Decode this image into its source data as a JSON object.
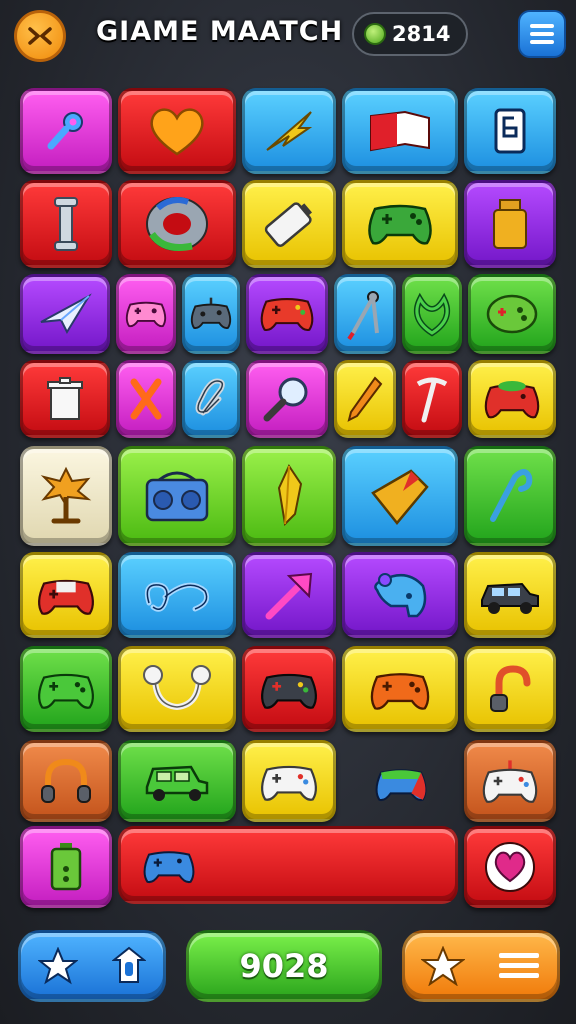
{
  "header": {
    "title": "GIAME MAATCH",
    "coins": "2814",
    "close_icon": "close-icon",
    "menu_icon": "hamburger-menu-icon"
  },
  "board": {
    "tiles": [
      {
        "name": "wrench",
        "color": "magenta"
      },
      {
        "name": "heart",
        "color": "red"
      },
      {
        "name": "leaf",
        "color": "blue"
      },
      {
        "name": "flag",
        "color": "blue"
      },
      {
        "name": "phone",
        "color": "blue"
      },
      {
        "name": "bone",
        "color": "red"
      },
      {
        "name": "ring",
        "color": "red"
      },
      {
        "name": "battery",
        "color": "yellow"
      },
      {
        "name": "gamepad",
        "color": "yellow"
      },
      {
        "name": "jar",
        "color": "purple"
      },
      {
        "name": "plane",
        "color": "purple"
      },
      {
        "name": "gamepad",
        "color": "magenta"
      },
      {
        "name": "gamepad",
        "color": "blue"
      },
      {
        "name": "gamepad",
        "color": "purple"
      },
      {
        "name": "tool",
        "color": "blue"
      },
      {
        "name": "knot",
        "color": "green"
      },
      {
        "name": "blob",
        "color": "green"
      },
      {
        "name": "trash",
        "color": "red"
      },
      {
        "name": "cross",
        "color": "magenta"
      },
      {
        "name": "clip",
        "color": "blue"
      },
      {
        "name": "magnifier",
        "color": "magenta"
      },
      {
        "name": "pencil",
        "color": "yellow"
      },
      {
        "name": "pickaxe",
        "color": "red"
      },
      {
        "name": "gamepad",
        "color": "yellow"
      },
      {
        "name": "tree",
        "color": "cream"
      },
      {
        "name": "boombox",
        "color": "lime"
      },
      {
        "name": "crystal",
        "color": "lime"
      },
      {
        "name": "gem",
        "color": "blue"
      },
      {
        "name": "pin",
        "color": "green"
      },
      {
        "name": "gamepad",
        "color": "yellow"
      },
      {
        "name": "clip",
        "color": "blue"
      },
      {
        "name": "arrow",
        "color": "purple"
      },
      {
        "name": "elephant",
        "color": "purple"
      },
      {
        "name": "car",
        "color": "yellow"
      },
      {
        "name": "gamepad",
        "color": "green"
      },
      {
        "name": "bone",
        "color": "yellow"
      },
      {
        "name": "gamepad",
        "color": "red"
      },
      {
        "name": "gamepad",
        "color": "yellow"
      },
      {
        "name": "hook",
        "color": "yellow"
      },
      {
        "name": "headphones",
        "color": "orange"
      },
      {
        "name": "car",
        "color": "green"
      },
      {
        "name": "gamepad",
        "color": "yellow"
      },
      {
        "name": "gamepad",
        "color": "none"
      },
      {
        "name": "gamepad",
        "color": "orange"
      },
      {
        "name": "battery",
        "color": "magenta"
      },
      {
        "name": "gamepad",
        "color": "red"
      },
      {
        "name": "heart",
        "color": "red"
      }
    ]
  },
  "footer": {
    "score": "9028",
    "left_icons": [
      "star-icon",
      "shield-icon"
    ],
    "right_icons": [
      "star-icon",
      "hamburger-menu-icon"
    ]
  }
}
